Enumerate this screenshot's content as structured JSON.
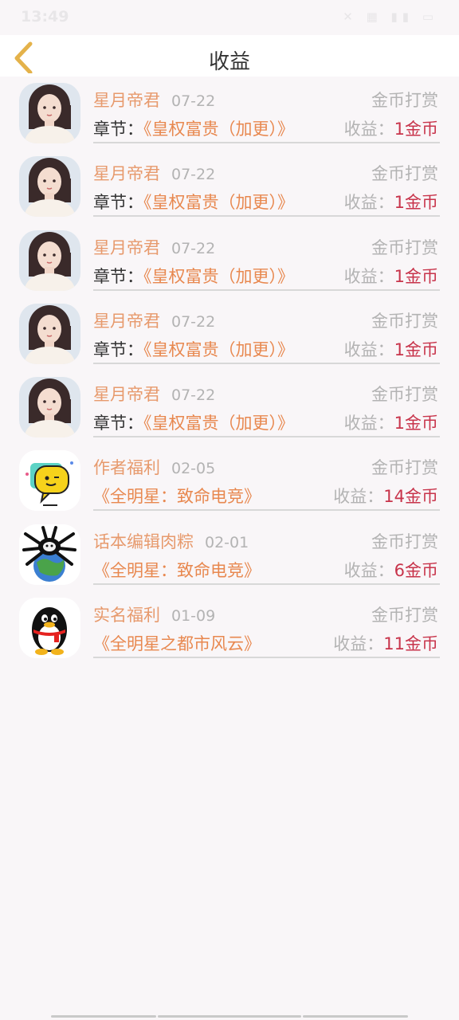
{
  "status_bar": {
    "time": "13:49",
    "icons": "✕ ▦ ▮▮ ▭"
  },
  "header": {
    "title": "收益"
  },
  "records": [
    {
      "avatar": "portrait-avatar",
      "name": "星月帝君",
      "date": "07-22",
      "type": "金币打赏",
      "chapter_label": "章节：",
      "chapter": "《皇权富贵（加更）》",
      "income_label": "收益：",
      "income": "1金币"
    },
    {
      "avatar": "portrait-avatar",
      "name": "星月帝君",
      "date": "07-22",
      "type": "金币打赏",
      "chapter_label": "章节：",
      "chapter": "《皇权富贵（加更）》",
      "income_label": "收益：",
      "income": "1金币"
    },
    {
      "avatar": "portrait-avatar",
      "name": "星月帝君",
      "date": "07-22",
      "type": "金币打赏",
      "chapter_label": "章节：",
      "chapter": "《皇权富贵（加更）》",
      "income_label": "收益：",
      "income": "1金币"
    },
    {
      "avatar": "portrait-avatar",
      "name": "星月帝君",
      "date": "07-22",
      "type": "金币打赏",
      "chapter_label": "章节：",
      "chapter": "《皇权富贵（加更）》",
      "income_label": "收益：",
      "income": "1金币"
    },
    {
      "avatar": "portrait-avatar",
      "name": "星月帝君",
      "date": "07-22",
      "type": "金币打赏",
      "chapter_label": "章节：",
      "chapter": "《皇权富贵（加更）》",
      "income_label": "收益：",
      "income": "1金币"
    },
    {
      "avatar": "chat-bubble-avatar",
      "name": "作者福利",
      "date": "02-05",
      "type": "金币打赏",
      "chapter_label": "",
      "chapter": "《全明星：致命电竞》",
      "income_label": "收益：",
      "income": "14金币"
    },
    {
      "avatar": "globe-spider-avatar",
      "name": "话本编辑肉粽",
      "date": "02-01",
      "type": "金币打赏",
      "chapter_label": "",
      "chapter": "《全明星：致命电竞》",
      "income_label": "收益：",
      "income": "6金币"
    },
    {
      "avatar": "penguin-avatar",
      "name": "实名福利",
      "date": "01-09",
      "type": "金币打赏",
      "chapter_label": "",
      "chapter": "《全明星之都市风云》",
      "income_label": "收益：",
      "income": "11金币"
    }
  ],
  "colors": {
    "name": "#e79a6d",
    "chapter": "#e8884f",
    "income_value": "#c8344b",
    "muted": "#b3b3b3",
    "back_arrow": "#e4b24a"
  }
}
